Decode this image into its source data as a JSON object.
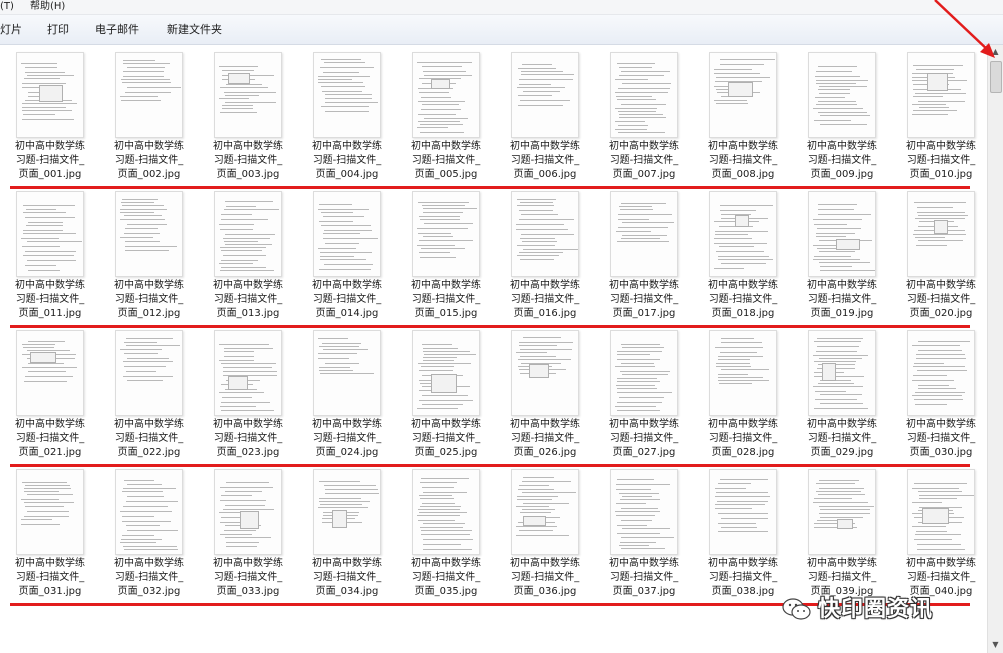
{
  "menubar": {
    "items": [
      "(T)",
      "帮助(H)"
    ]
  },
  "toolbar": {
    "buttons": [
      "灯片",
      "打印",
      "电子邮件",
      "新建文件夹"
    ]
  },
  "files": {
    "name_line1": "初中高中数学练",
    "name_line2": "习题-扫描文件_",
    "page_labels": [
      "页面_001.jpg",
      "页面_002.jpg",
      "页面_003.jpg",
      "页面_004.jpg",
      "页面_005.jpg",
      "页面_006.jpg",
      "页面_007.jpg",
      "页面_008.jpg",
      "页面_009.jpg",
      "页面_010.jpg",
      "页面_011.jpg",
      "页面_012.jpg",
      "页面_013.jpg",
      "页面_014.jpg",
      "页面_015.jpg",
      "页面_016.jpg",
      "页面_017.jpg",
      "页面_018.jpg",
      "页面_019.jpg",
      "页面_020.jpg",
      "页面_021.jpg",
      "页面_022.jpg",
      "页面_023.jpg",
      "页面_024.jpg",
      "页面_025.jpg",
      "页面_026.jpg",
      "页面_027.jpg",
      "页面_028.jpg",
      "页面_029.jpg",
      "页面_030.jpg",
      "页面_031.jpg",
      "页面_032.jpg",
      "页面_033.jpg",
      "页面_034.jpg",
      "页面_035.jpg",
      "页面_036.jpg",
      "页面_037.jpg",
      "页面_038.jpg",
      "页面_039.jpg",
      "页面_040.jpg"
    ]
  },
  "annotation_color": "#e21c1c",
  "watermark": {
    "icon": "wechat-icon",
    "text": "快印圈资讯"
  },
  "scrollbar": {
    "up_icon": "scroll-up-arrow-icon",
    "down_icon": "scroll-down-arrow-icon"
  }
}
